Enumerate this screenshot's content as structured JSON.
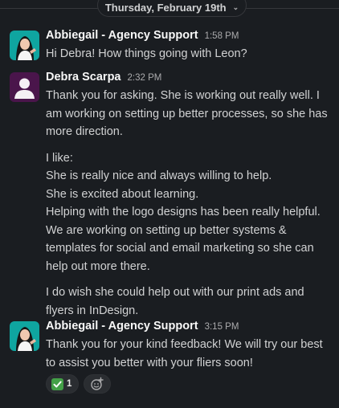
{
  "date_divider": {
    "label": "Thursday, February 19th"
  },
  "messages": [
    {
      "sender": "Abbiegail - Agency Support",
      "time": "1:58 PM",
      "paragraphs": [
        "Hi Debra! How things going with Leon?"
      ]
    },
    {
      "sender": "Debra Scarpa",
      "time": "2:32 PM",
      "paragraphs": [
        "Thank you for asking. She is working out really well. I am working on setting up better processes, so she has more direction.",
        "I like:",
        "She is really nice and always willing to help.",
        "She is excited about learning.",
        "Helping with the logo designs has been really helpful. We are working on setting up better systems & templates for social and email marketing so she can help out more there.",
        "I do wish she could help out with our print ads and flyers in InDesign."
      ]
    },
    {
      "sender": "Abbiegail - Agency Support",
      "time": "3:15 PM",
      "paragraphs": [
        "Thank you for your kind feedback! We will try our best to assist you better with your fliers soon!"
      ],
      "reactions": [
        {
          "emoji_icon": "white-check-mark-icon",
          "count": "1"
        }
      ]
    }
  ],
  "colors": {
    "background": "#1a1d21",
    "agent_avatar_bg": "#0fa5a0",
    "user_avatar_bg": "#4a154b",
    "check_green": "#43a047"
  }
}
